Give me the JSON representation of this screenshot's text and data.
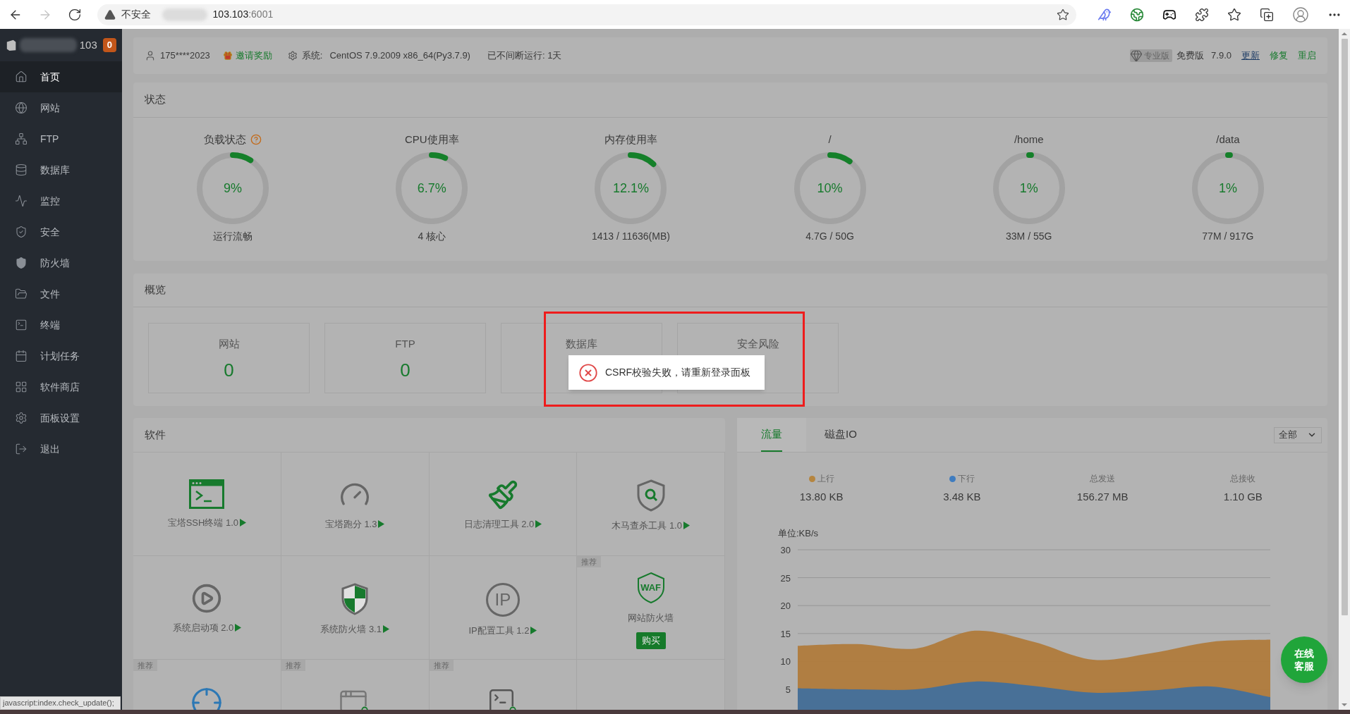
{
  "browser": {
    "security_label": "不安全",
    "address_host": "103.103",
    "address_port": ":6001",
    "forward_disabled": true
  },
  "sidebar": {
    "server_name": "103",
    "badge": "0",
    "items": [
      {
        "label": "首页",
        "selected": true
      },
      {
        "label": "网站",
        "selected": false
      },
      {
        "label": "FTP",
        "selected": false
      },
      {
        "label": "数据库",
        "selected": false
      },
      {
        "label": "监控",
        "selected": false
      },
      {
        "label": "安全",
        "selected": false
      },
      {
        "label": "防火墙",
        "selected": false
      },
      {
        "label": "文件",
        "selected": false
      },
      {
        "label": "终端",
        "selected": false
      },
      {
        "label": "计划任务",
        "selected": false
      },
      {
        "label": "软件商店",
        "selected": false
      },
      {
        "label": "面板设置",
        "selected": false
      },
      {
        "label": "退出",
        "selected": false
      }
    ]
  },
  "header": {
    "user": "175****2023",
    "invite": "邀请奖励",
    "system_label": "系统:",
    "system": "CentOS 7.9.2009 x86_64(Py3.7.9)",
    "uptime": "已不间断运行: 1天",
    "pro_badge": "专业版",
    "edition": "免费版",
    "version": "7.9.0",
    "links": [
      {
        "label": "更新",
        "kind": "update"
      },
      {
        "label": "修复",
        "kind": "action"
      },
      {
        "label": "重启",
        "kind": "action"
      }
    ]
  },
  "status": {
    "title": "状态",
    "gauges": [
      {
        "title": "负载状态",
        "help": true,
        "value": "9%",
        "level": 0.09,
        "caption": "运行流畅"
      },
      {
        "title": "CPU使用率",
        "help": false,
        "value": "6.7%",
        "level": 0.067,
        "caption": "4 核心"
      },
      {
        "title": "内存使用率",
        "help": false,
        "value": "12.1%",
        "level": 0.121,
        "caption": "1413 / 11636(MB)"
      },
      {
        "title": "/",
        "help": false,
        "value": "10%",
        "level": 0.1,
        "caption": "4.7G / 50G"
      },
      {
        "title": "/home",
        "help": false,
        "value": "1%",
        "level": 0.01,
        "caption": "33M / 55G"
      },
      {
        "title": "/data",
        "help": false,
        "value": "1%",
        "level": 0.01,
        "caption": "77M / 917G"
      }
    ]
  },
  "overview": {
    "title": "概览",
    "cards": [
      {
        "label": "网站",
        "value": "0"
      },
      {
        "label": "FTP",
        "value": "0"
      },
      {
        "label": "数据库"
      },
      {
        "label": "安全风险"
      }
    ]
  },
  "software": {
    "title": "软件",
    "items": [
      {
        "name": "宝塔SSH终端 1.0",
        "recommended": false
      },
      {
        "name": "宝塔跑分 1.3",
        "recommended": false
      },
      {
        "name": "日志清理工具 2.0",
        "recommended": false
      },
      {
        "name": "木马查杀工具 1.0",
        "recommended": false
      },
      {
        "name": "系统启动项 2.0",
        "recommended": false
      },
      {
        "name": "系统防火墙 3.1",
        "recommended": false
      },
      {
        "icon_text": "IP",
        "name": "IP配置工具 1.2",
        "recommended": false
      },
      {
        "icon_text": "WAF",
        "name": "网站防火墙",
        "recommended": true,
        "recommend_label": "推荐",
        "buy": "购买"
      },
      {
        "recommended": true,
        "recommend_label": "推荐"
      },
      {
        "recommended": true,
        "recommend_label": "推荐"
      },
      {
        "recommended": true,
        "recommend_label": "推荐"
      }
    ]
  },
  "traffic": {
    "tabs": [
      {
        "label": "流量",
        "selected": true
      },
      {
        "label": "磁盘IO",
        "selected": false
      }
    ],
    "select": "全部",
    "stats": [
      {
        "label": "上行",
        "value": "13.80 KB",
        "color": "#b5853f"
      },
      {
        "label": "下行",
        "value": "3.48 KB",
        "color": "#3f7cbf"
      },
      {
        "label": "总发送",
        "value": "156.27 MB"
      },
      {
        "label": "总接收",
        "value": "1.10 GB"
      }
    ],
    "chart_data": {
      "type": "area",
      "grid": true,
      "ylabel": "单位:KB/s",
      "ylim": [
        0,
        30
      ],
      "yticks": [
        5,
        10,
        15,
        20,
        25,
        30
      ],
      "series": [
        {
          "color": "#b07a38",
          "values": [
            12.8,
            13.1,
            12.3,
            15.5,
            13.5,
            10.3,
            11.5,
            13.5,
            13.9
          ]
        },
        {
          "color": "#3f6f9e",
          "values": [
            5.2,
            5.0,
            5.0,
            6.4,
            5.6,
            4.4,
            4.8,
            5.5,
            3.6
          ]
        }
      ]
    }
  },
  "chat_button": "在线客服",
  "toast": {
    "kind": "error",
    "message": "CSRF校验失败，请重新登录面板"
  },
  "highlight": true,
  "status_tooltip": "javascript:index.check_update();"
}
